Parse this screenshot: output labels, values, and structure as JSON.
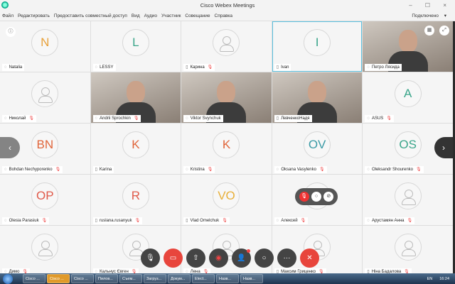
{
  "window": {
    "title": "Cisco Webex Meetings",
    "controls": "– ☐ ×"
  },
  "menu": [
    "Файл",
    "Редактировать",
    "Предоставить совместный доступ",
    "Вид",
    "Аудио",
    "Участник",
    "Совещание",
    "Справка"
  ],
  "status": "Подключено",
  "tiles": [
    {
      "name": "Natalia",
      "initials": "N",
      "color": "#e8a13a",
      "dev": "phone",
      "muted": false
    },
    {
      "name": "LESSY",
      "initials": "L",
      "color": "#3aa58a",
      "dev": "phone",
      "muted": false
    },
    {
      "name": "Карина",
      "initials": "",
      "dev": "mobile",
      "muted": true
    },
    {
      "name": "Ivan",
      "initials": "I",
      "color": "#3aa58a",
      "dev": "mobile",
      "muted": false,
      "selected": true
    },
    {
      "name": "Петро Лясида",
      "video": true,
      "dev": "phone",
      "muted": false
    },
    {
      "name": "Николай",
      "initials": "",
      "dev": "phone",
      "muted": true
    },
    {
      "name": "Andrii Sprochkin",
      "video": true,
      "dev": "phone",
      "muted": true
    },
    {
      "name": "Viktor Svynchuk",
      "video": true,
      "dev": "phone",
      "muted": false
    },
    {
      "name": "ЛевченкоНадя",
      "video": true,
      "dev": "mobile",
      "muted": false
    },
    {
      "name": "ASUS",
      "initials": "A",
      "color": "#3aa58a",
      "dev": "phone",
      "muted": true
    },
    {
      "name": "Bohdan Nechyporenko",
      "initials": "BN",
      "color": "#e0653a",
      "dev": "phone",
      "muted": true
    },
    {
      "name": "Karina",
      "initials": "K",
      "color": "#e0653a",
      "dev": "mobile",
      "muted": false
    },
    {
      "name": "Kristina",
      "initials": "K",
      "color": "#e0653a",
      "dev": "phone",
      "muted": true
    },
    {
      "name": "Oksana Vasylenko",
      "initials": "OV",
      "color": "#3a9aa5",
      "dev": "phone",
      "muted": true
    },
    {
      "name": "Oleksandr Shourenko",
      "initials": "OS",
      "color": "#3aa58a",
      "dev": "phone",
      "muted": true
    },
    {
      "name": "Olesia Parasiuk",
      "initials": "OP",
      "color": "#e05a4a",
      "dev": "phone",
      "muted": true
    },
    {
      "name": "ruslana.rusanyuk",
      "initials": "R",
      "color": "#e05a4a",
      "dev": "mobile",
      "muted": true
    },
    {
      "name": "Vlad Omelchuk",
      "initials": "VO",
      "color": "#e8b03a",
      "dev": "mobile",
      "muted": true
    },
    {
      "name": "Алексей",
      "initials": "",
      "dev": "phone",
      "muted": true
    },
    {
      "name": "Арустамян Анна",
      "initials": "",
      "dev": "phone",
      "muted": true
    },
    {
      "name": "Димо",
      "initials": "",
      "dev": "phone",
      "muted": true
    },
    {
      "name": "Кальнус Євген",
      "initials": "",
      "dev": "phone",
      "muted": true
    },
    {
      "name": "Лена",
      "initials": "",
      "dev": "phone",
      "muted": true
    },
    {
      "name": "Максим Гриценко",
      "initials": "",
      "dev": "mobile",
      "muted": true
    },
    {
      "name": "Ніна Бадалова",
      "initials": "",
      "dev": "mobile",
      "muted": true
    }
  ],
  "taskbar": {
    "items": [
      "Cisco ...",
      "Cisco ...",
      "Cisco ...",
      "Пилов...",
      "Съем...",
      "Загруз...",
      "Докум...",
      "Elect...",
      "Назв...",
      "Назв..."
    ],
    "lang": "EN",
    "time": "16:24"
  }
}
